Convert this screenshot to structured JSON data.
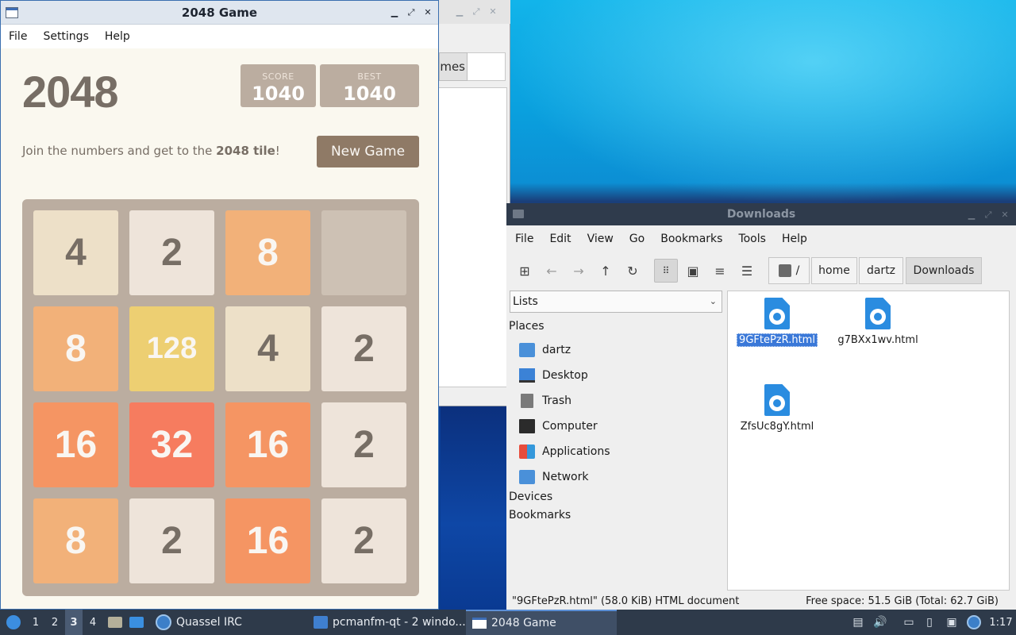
{
  "game_window": {
    "title": "2048 Game",
    "menu": [
      "File",
      "Settings",
      "Help"
    ],
    "logo": "2048",
    "score_label": "SCORE",
    "score_value": "1040",
    "best_label": "BEST",
    "best_value": "1040",
    "tagline_pre": "Join the numbers and get to the ",
    "tagline_bold": "2048 tile",
    "tagline_post": "!",
    "new_game_label": "New Game",
    "board": [
      [
        "4",
        "2",
        "8",
        ""
      ],
      [
        "8",
        "128",
        "4",
        "2"
      ],
      [
        "16",
        "32",
        "16",
        "2"
      ],
      [
        "8",
        "2",
        "16",
        "2"
      ]
    ],
    "tile_colors": {
      "empty": "#cdc1b4",
      "2": "#eee4da",
      "4": "#ede0c8",
      "8": "#f2b179",
      "16": "#f59563",
      "32": "#f67c5f",
      "128": "#edcf72"
    }
  },
  "background_window": {
    "tab_fragment": "mes"
  },
  "file_manager": {
    "title": "Downloads",
    "menu": [
      "File",
      "Edit",
      "View",
      "Go",
      "Bookmarks",
      "Tools",
      "Help"
    ],
    "path": [
      "/",
      "home",
      "dartz",
      "Downloads"
    ],
    "side_pane_mode": "Lists",
    "places_header": "Places",
    "places": [
      "dartz",
      "Desktop",
      "Trash",
      "Computer",
      "Applications",
      "Network"
    ],
    "devices_header": "Devices",
    "bookmarks_header": "Bookmarks",
    "files": [
      "9GFtePzR.html",
      "g7BXx1wv.html",
      "ZfsUc8gY.html"
    ],
    "selected_file": "9GFtePzR.html",
    "status_left": "\"9GFtePzR.html\" (58.0 KiB) HTML document",
    "status_right": "Free space: 51.5 GiB (Total: 62.7 GiB)"
  },
  "taskbar": {
    "desktops": [
      "1",
      "2",
      "3",
      "4"
    ],
    "current_desktop": "3",
    "tasks": [
      "Quassel IRC",
      "pcmanfm-qt - 2 windo...",
      "2048 Game"
    ],
    "clock": "1:17"
  }
}
